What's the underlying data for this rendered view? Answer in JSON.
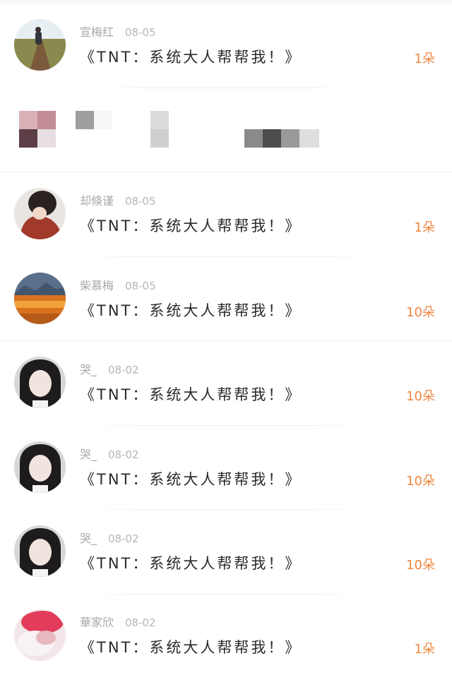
{
  "items": [
    {
      "user": "宣梅红",
      "date": "08-05",
      "title": "《TNT：系统大人帮帮我！》",
      "count": "1朵",
      "avatar_icon": "landscape-boardwalk"
    },
    {
      "user": "却倏谨",
      "date": "08-05",
      "title": "《TNT：系统大人帮帮我！》",
      "count": "1朵",
      "avatar_icon": "person-red-sweater"
    },
    {
      "user": "柴慕梅",
      "date": "08-05",
      "title": "《TNT：系统大人帮帮我！》",
      "count": "10朵",
      "avatar_icon": "autumn-forest"
    },
    {
      "user": "哭_",
      "date": "08-02",
      "title": "《TNT：系统大人帮帮我！》",
      "count": "10朵",
      "avatar_icon": "girl-portrait"
    },
    {
      "user": "哭_",
      "date": "08-02",
      "title": "《TNT：系统大人帮帮我！》",
      "count": "10朵",
      "avatar_icon": "girl-portrait"
    },
    {
      "user": "哭_",
      "date": "08-02",
      "title": "《TNT：系统大人帮帮我！》",
      "count": "10朵",
      "avatar_icon": "girl-portrait"
    },
    {
      "user": "華家欣",
      "date": "08-02",
      "title": "《TNT：系统大人帮帮我！》",
      "count": "1朵",
      "avatar_icon": "pink-scarf"
    }
  ],
  "colors": {
    "accent": "#f08540",
    "title_text": "#2a2a2a",
    "meta_text": "#a9a9a9"
  }
}
